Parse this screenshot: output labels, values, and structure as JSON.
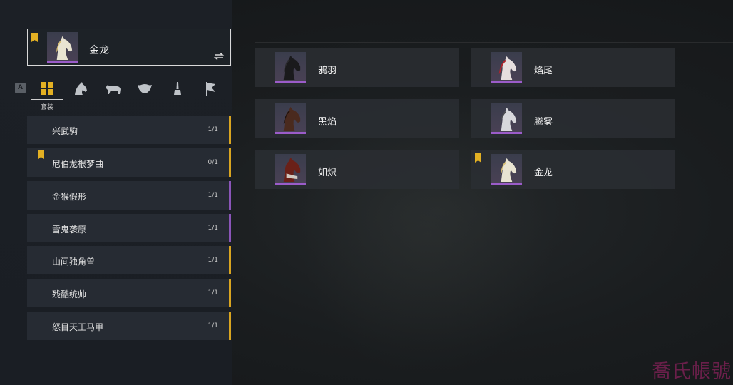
{
  "colors": {
    "gold": "#e3b023",
    "purple": "#8b55b8",
    "selected_border": "#d9d9d9"
  },
  "selected": {
    "name": "金龙",
    "bookmarked": true,
    "icon": "white-horse-icon",
    "action_icon": "swap-icon"
  },
  "filter_key": "A",
  "tabs": [
    {
      "icon": "grid-icon",
      "active": true
    },
    {
      "icon": "horse-head-icon",
      "active": false
    },
    {
      "icon": "horse-body-icon",
      "active": false
    },
    {
      "icon": "saddle-icon",
      "active": false
    },
    {
      "icon": "brush-icon",
      "active": false
    },
    {
      "icon": "flag-icon",
      "active": false
    }
  ],
  "active_tab_label": "套装",
  "sets": [
    {
      "name": "兴武驹",
      "count": "1/1",
      "rarity": "gold",
      "bookmarked": false
    },
    {
      "name": "尼伯龙根梦曲",
      "count": "0/1",
      "rarity": "gold",
      "bookmarked": true
    },
    {
      "name": "金猴假形",
      "count": "1/1",
      "rarity": "purple",
      "bookmarked": false
    },
    {
      "name": "雪鬼袭原",
      "count": "1/1",
      "rarity": "purple",
      "bookmarked": false
    },
    {
      "name": "山间独角兽",
      "count": "1/1",
      "rarity": "gold",
      "bookmarked": false
    },
    {
      "name": "残酷统帅",
      "count": "1/1",
      "rarity": "gold",
      "bookmarked": false
    },
    {
      "name": "怒目天王马甲",
      "count": "1/1",
      "rarity": "gold",
      "bookmarked": false
    }
  ],
  "horses": [
    {
      "name": "鸦羽",
      "bookmarked": false,
      "coat": "black"
    },
    {
      "name": "焰尾",
      "bookmarked": false,
      "coat": "red-mane"
    },
    {
      "name": "黑焰",
      "bookmarked": false,
      "coat": "dark-brown"
    },
    {
      "name": "腾雾",
      "bookmarked": false,
      "coat": "grey"
    },
    {
      "name": "如炽",
      "bookmarked": false,
      "coat": "red-armored"
    },
    {
      "name": "金龙",
      "bookmarked": true,
      "coat": "white-gold"
    }
  ],
  "watermark": "喬氏帳號"
}
